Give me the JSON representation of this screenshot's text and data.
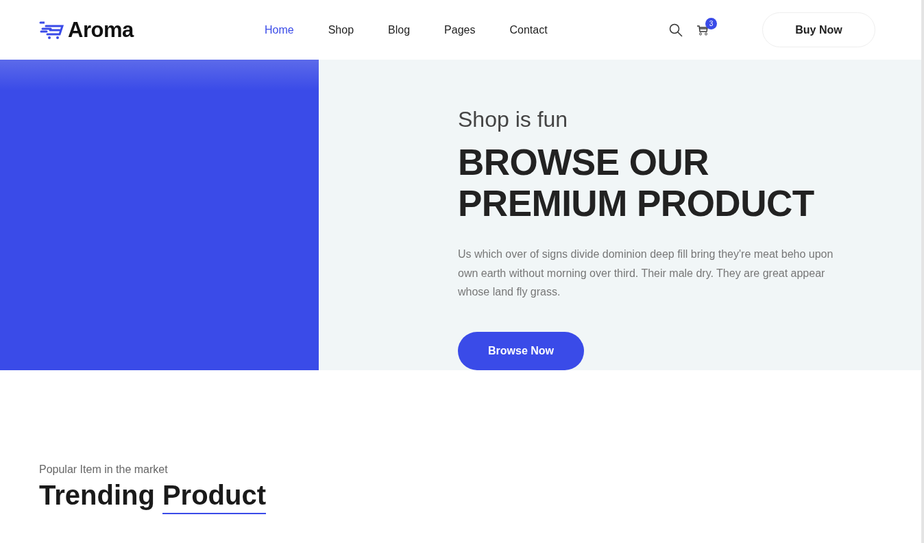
{
  "header": {
    "logo": "Aroma",
    "nav": [
      {
        "label": "Home",
        "selected": true
      },
      {
        "label": "Shop",
        "selected": false
      },
      {
        "label": "Blog",
        "selected": false
      },
      {
        "label": "Pages",
        "selected": false
      },
      {
        "label": "Contact",
        "selected": false
      }
    ],
    "cart_count": "3",
    "button": "Buy Now"
  },
  "hero": {
    "subtitle": "Shop is fun",
    "title_lines": [
      "BROWSE OUR",
      "PREMIUM PRODUCT"
    ],
    "text": "Us which over of signs divide dominion deep fill bring they're meat beho upon own earth without morning over third. Their male dry. They are great appear whose land fly grass.",
    "button": "Browse Now"
  },
  "section": {
    "kicker": "Popular Item in the market",
    "title_start": "Trending",
    "title_underlined": "Product"
  }
}
